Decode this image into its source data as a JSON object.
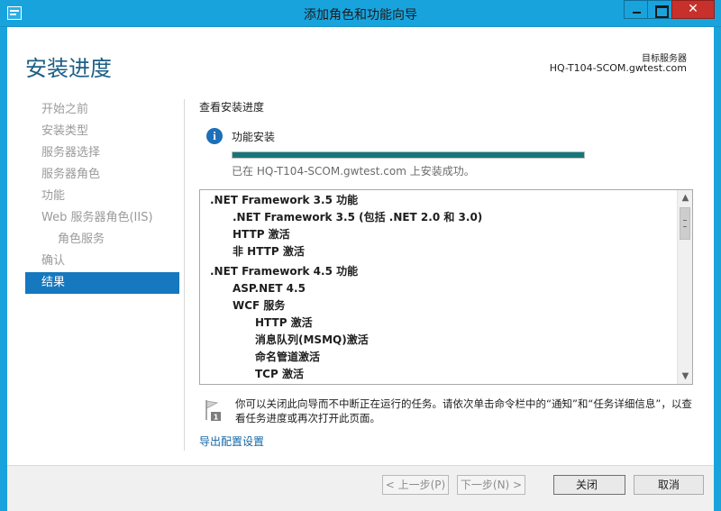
{
  "window": {
    "title": "添加角色和功能向导",
    "close_glyph": "✕"
  },
  "header": {
    "page_title": "安装进度",
    "target_label": "目标服务器",
    "target_server": "HQ-T104-SCOM.gwtest.com"
  },
  "nav": {
    "items": [
      {
        "label": "开始之前",
        "state": "disabled"
      },
      {
        "label": "安装类型",
        "state": "disabled"
      },
      {
        "label": "服务器选择",
        "state": "disabled"
      },
      {
        "label": "服务器角色",
        "state": "disabled"
      },
      {
        "label": "功能",
        "state": "disabled"
      },
      {
        "label": "Web 服务器角色(IIS)",
        "state": "disabled"
      },
      {
        "label": "角色服务",
        "state": "disabled"
      },
      {
        "label": "确认",
        "state": "disabled"
      },
      {
        "label": "结果",
        "state": "active"
      }
    ]
  },
  "content": {
    "section_title": "查看安装进度",
    "status_label": "功能安装",
    "progress": 1.0,
    "success_message": "已在 HQ-T104-SCOM.gwtest.com 上安装成功。",
    "results": [
      {
        "text": ".NET Framework 3.5 功能",
        "level": 0
      },
      {
        "text": ".NET Framework 3.5 (包括 .NET 2.0 和 3.0)",
        "level": 1
      },
      {
        "text": "HTTP 激活",
        "level": 1
      },
      {
        "text": "非 HTTP 激活",
        "level": 1
      },
      {
        "text": ".NET Framework 4.5 功能",
        "level": 0
      },
      {
        "text": "ASP.NET 4.5",
        "level": 1
      },
      {
        "text": "WCF 服务",
        "level": 1
      },
      {
        "text": "HTTP 激活",
        "level": 2
      },
      {
        "text": "消息队列(MSMQ)激活",
        "level": 2
      },
      {
        "text": "命名管道激活",
        "level": 2
      },
      {
        "text": "TCP 激活",
        "level": 2
      }
    ],
    "note": "你可以关闭此向导而不中断正在运行的任务。请依次单击命令栏中的“通知”和“任务详细信息”，以查看任务进度或再次打开此页面。",
    "export_link": "导出配置设置"
  },
  "footer": {
    "prev_label": "< 上一步(P)",
    "next_label": "下一步(N) >",
    "close_label": "关闭",
    "cancel_label": "取消"
  },
  "colors": {
    "titlebar": "#19a3dd",
    "nav_active": "#1678be",
    "progress_fill": "#16767a",
    "link": "#1467a6",
    "page_title": "#1c5f86"
  }
}
